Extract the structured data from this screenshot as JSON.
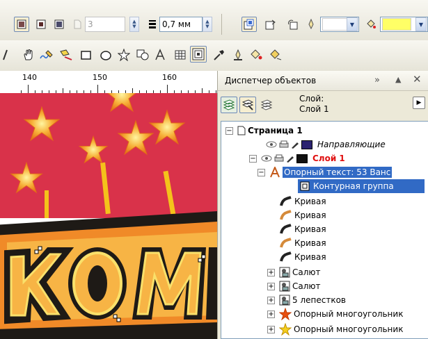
{
  "toolbar": {
    "page_number": "3",
    "outline_width": "0,7 мм",
    "fill_color": "#ffff66",
    "outline_color": "#ffffff"
  },
  "ruler": {
    "labels": [
      "140",
      "150",
      "160"
    ]
  },
  "canvas": {
    "background": "#d9324a",
    "star_color": "#f7b23a"
  },
  "docker": {
    "title": "Диспетчер объектов",
    "layer_label": "Слой:",
    "layer_name": "Слой 1",
    "tree": [
      {
        "label": "Страница 1",
        "style": "bold"
      },
      {
        "label": "Направляющие",
        "style": "italic",
        "swatch": "#2b2370"
      },
      {
        "label": "Слой 1",
        "style": "red-bold",
        "swatch": "#111111"
      },
      {
        "label": "Опорный текст: 53 Ванс",
        "style": "selected"
      },
      {
        "label": "Контурная группа",
        "style": "selected"
      },
      {
        "label": "Кривая"
      },
      {
        "label": "Кривая"
      },
      {
        "label": "Кривая"
      },
      {
        "label": "Кривая"
      },
      {
        "label": "Кривая"
      },
      {
        "label": "Салют"
      },
      {
        "label": "Салют"
      },
      {
        "label": "5 лепестков"
      },
      {
        "label": "Опорный многоугольник"
      },
      {
        "label": "Опорный многоугольник"
      }
    ]
  }
}
